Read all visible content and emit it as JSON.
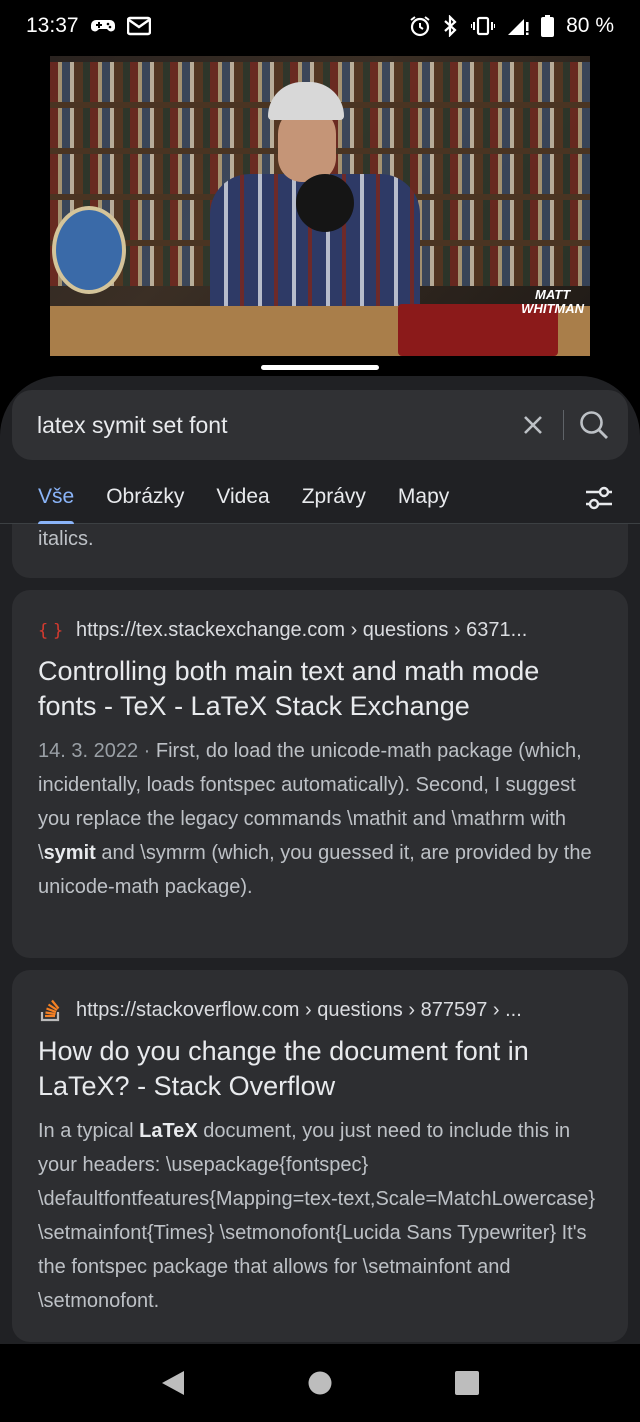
{
  "status_bar": {
    "time": "13:37",
    "left_icons": [
      "game-controller-icon",
      "mail-icon"
    ],
    "right_icons": [
      "alarm-icon",
      "bluetooth-icon",
      "vibrate-icon",
      "signal-icon",
      "battery-icon"
    ],
    "battery": "80 %"
  },
  "video": {
    "watermark_line1": "MATT",
    "watermark_line2": "WHITMAN"
  },
  "search": {
    "query": "latex symit set font"
  },
  "tabs": [
    {
      "label": "Vše",
      "active": true
    },
    {
      "label": "Obrázky",
      "active": false
    },
    {
      "label": "Videa",
      "active": false
    },
    {
      "label": "Zprávy",
      "active": false
    },
    {
      "label": "Mapy",
      "active": false
    }
  ],
  "previous_result_tail": "italics.",
  "results": [
    {
      "favicon": "stackexchange-tex-icon",
      "url": "https://tex.stackexchange.com › questions › 6371...",
      "title": "Controlling both main text and math mode fonts - TeX - LaTeX Stack Exchange",
      "date": "14. 3. 2022",
      "date_sep": " · ",
      "snippet_before": "First, do load the unicode-math package (which, incidentally, loads fontspec automatically). Second, I suggest you replace the legacy commands \\mathit and \\mathrm with \\",
      "snippet_bold": "symit",
      "snippet_after": " and \\symrm (which, you guessed it, are provided by the unicode-math package)."
    },
    {
      "favicon": "stackoverflow-icon",
      "url": "https://stackoverflow.com › questions › 877597 › ...",
      "title": "How do you change the document font in LaTeX? - Stack Overflow",
      "snippet_before": "In a typical ",
      "snippet_bold": "LaTeX",
      "snippet_after": " document, you just need to include this in your headers: \\usepackage{fontspec} \\defaultfontfeatures{Mapping=tex-text,Scale=MatchLowercase} \\setmainfont{Times} \\setmonofont{Lucida Sans Typewriter} It's the fontspec package that allows for \\setmainfont and \\setmonofont."
    }
  ],
  "nav": [
    "back-icon",
    "home-icon",
    "recents-icon"
  ]
}
